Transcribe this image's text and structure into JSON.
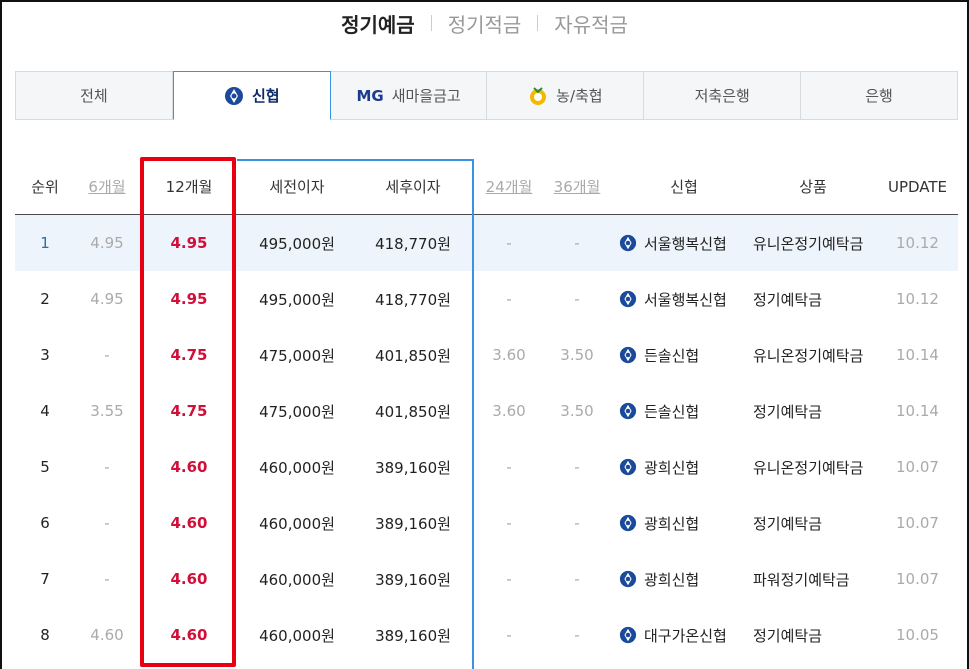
{
  "topnav": {
    "items": [
      "정기예금",
      "정기적금",
      "자유적금"
    ],
    "active": 0
  },
  "tabs": [
    {
      "label": "전체",
      "icon": ""
    },
    {
      "label": "신협",
      "icon": "shinhyup-logo-icon"
    },
    {
      "label": "새마을금고",
      "icon": "mg-logo-icon",
      "prefix": "MG"
    },
    {
      "label": "농/축협",
      "icon": "nonghyup-logo-icon"
    },
    {
      "label": "저축은행",
      "icon": ""
    },
    {
      "label": "은행",
      "icon": ""
    }
  ],
  "table": {
    "headers": {
      "rank": "순위",
      "m6": "6개월",
      "m12": "12개월",
      "pre": "세전이자",
      "post": "세후이자",
      "m24": "24개월",
      "m36": "36개월",
      "bank": "신협",
      "product": "상품",
      "update": "UPDATE"
    },
    "rows": [
      {
        "rank": "1",
        "m6": "4.95",
        "m12": "4.95",
        "pre": "495,000원",
        "post": "418,770원",
        "m24": "-",
        "m36": "-",
        "bank": "서울행복신협",
        "product": "유니온정기예탁금",
        "update": "10.12"
      },
      {
        "rank": "2",
        "m6": "4.95",
        "m12": "4.95",
        "pre": "495,000원",
        "post": "418,770원",
        "m24": "-",
        "m36": "-",
        "bank": "서울행복신협",
        "product": "정기예탁금",
        "update": "10.12"
      },
      {
        "rank": "3",
        "m6": "-",
        "m12": "4.75",
        "pre": "475,000원",
        "post": "401,850원",
        "m24": "3.60",
        "m36": "3.50",
        "bank": "든솔신협",
        "product": "유니온정기예탁금",
        "update": "10.14"
      },
      {
        "rank": "4",
        "m6": "3.55",
        "m12": "4.75",
        "pre": "475,000원",
        "post": "401,850원",
        "m24": "3.60",
        "m36": "3.50",
        "bank": "든솔신협",
        "product": "정기예탁금",
        "update": "10.14"
      },
      {
        "rank": "5",
        "m6": "-",
        "m12": "4.60",
        "pre": "460,000원",
        "post": "389,160원",
        "m24": "-",
        "m36": "-",
        "bank": "광희신협",
        "product": "유니온정기예탁금",
        "update": "10.07"
      },
      {
        "rank": "6",
        "m6": "-",
        "m12": "4.60",
        "pre": "460,000원",
        "post": "389,160원",
        "m24": "-",
        "m36": "-",
        "bank": "광희신협",
        "product": "정기예탁금",
        "update": "10.07"
      },
      {
        "rank": "7",
        "m6": "-",
        "m12": "4.60",
        "pre": "460,000원",
        "post": "389,160원",
        "m24": "-",
        "m36": "-",
        "bank": "광희신협",
        "product": "파워정기예탁금",
        "update": "10.07"
      },
      {
        "rank": "8",
        "m6": "4.60",
        "m12": "4.60",
        "pre": "460,000원",
        "post": "389,160원",
        "m24": "-",
        "m36": "-",
        "bank": "대구가온신협",
        "product": "정기예탁금",
        "update": "10.05"
      }
    ]
  },
  "colors": {
    "accent_blue": "#3a93e0",
    "rate_red": "#d0103a",
    "highlight_box": "#e60012",
    "row_highlight": "#eef4fb"
  }
}
